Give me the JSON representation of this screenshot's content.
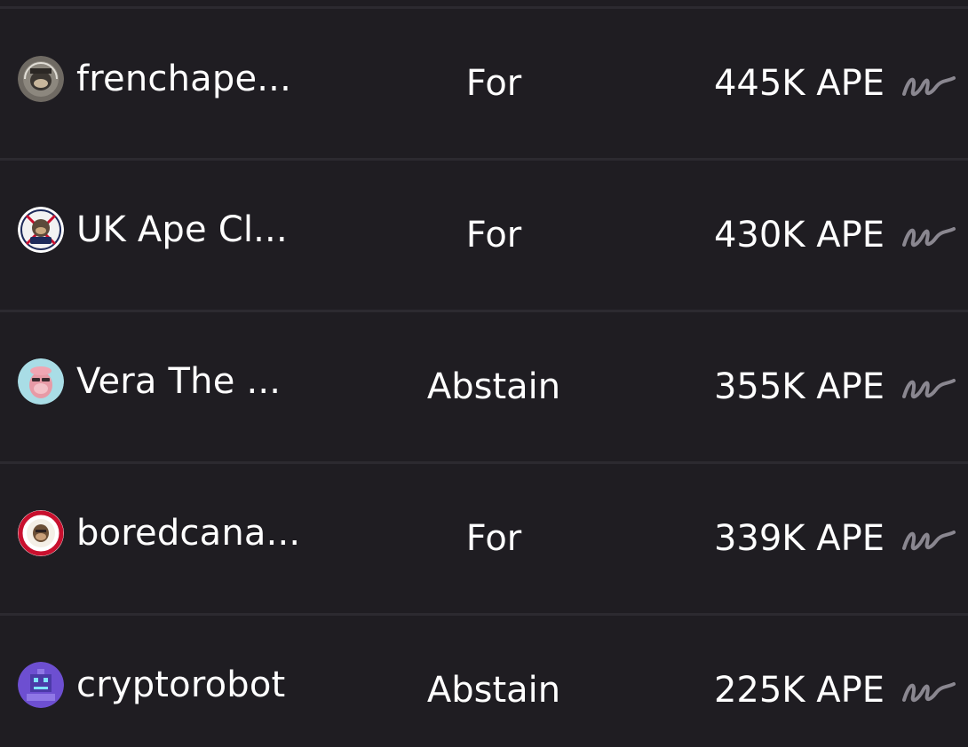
{
  "votes": [
    {
      "voter": "frenchape...",
      "choice": "For",
      "power": "445K APE",
      "avatar_icon": "frenchape-avatar",
      "signature_icon": "signature-icon"
    },
    {
      "voter": "UK Ape Cl...",
      "choice": "For",
      "power": "430K APE",
      "avatar_icon": "uk-ape-club-avatar",
      "signature_icon": "signature-icon"
    },
    {
      "voter": "Vera The ...",
      "choice": "Abstain",
      "power": "355K APE",
      "avatar_icon": "vera-avatar",
      "signature_icon": "signature-icon"
    },
    {
      "voter": "boredcana...",
      "choice": "For",
      "power": "339K APE",
      "avatar_icon": "boredcanada-avatar",
      "signature_icon": "signature-icon"
    },
    {
      "voter": "cryptorobot",
      "choice": "Abstain",
      "power": "225K APE",
      "avatar_icon": "cryptorobot-avatar",
      "signature_icon": "signature-icon"
    }
  ],
  "colors": {
    "background": "#1f1d22",
    "separator": "#2c2a30",
    "text": "#ffffff",
    "signature": "#8a8790"
  }
}
